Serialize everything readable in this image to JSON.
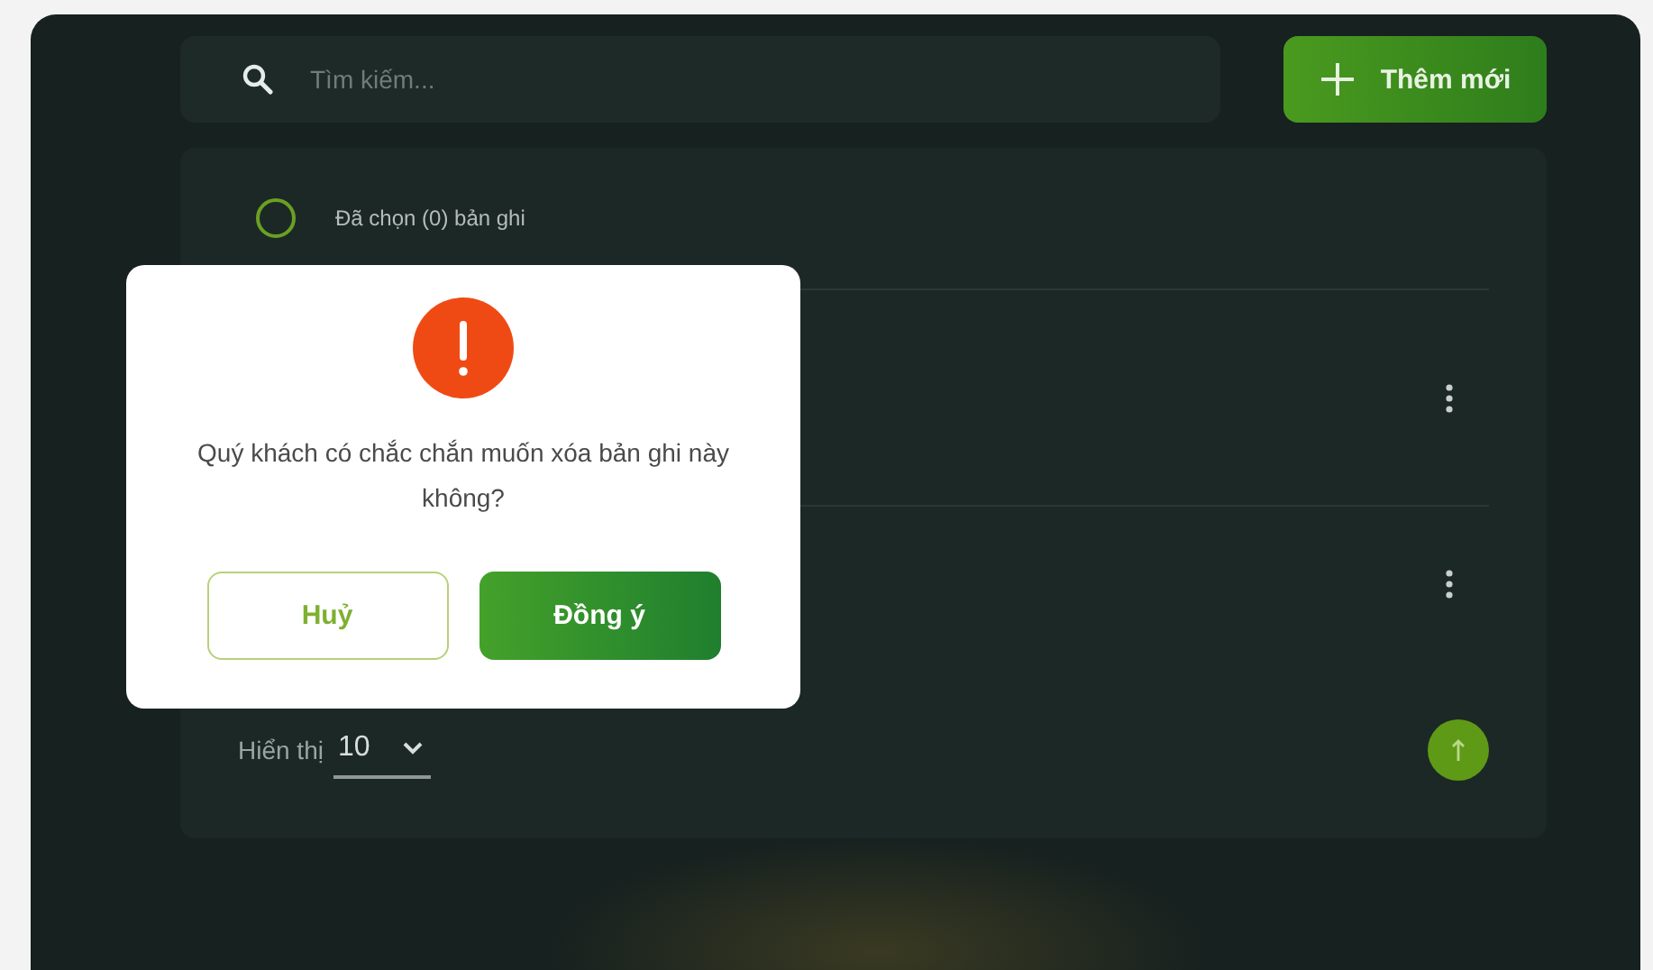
{
  "search": {
    "placeholder": "Tìm kiếm..."
  },
  "add_button": {
    "label": "Thêm mới"
  },
  "selection": {
    "checked": false,
    "label": "Đã chọn (0) bản ghi"
  },
  "footer": {
    "label": "Hiển thị",
    "page_size": "10"
  },
  "dialog": {
    "message": "Quý khách có chắc chắn muốn xóa bản ghi này không?",
    "buttons": [
      {
        "kind": "secondary",
        "label": "Huỷ"
      },
      {
        "kind": "primary",
        "label": "Đồng ý"
      }
    ]
  }
}
